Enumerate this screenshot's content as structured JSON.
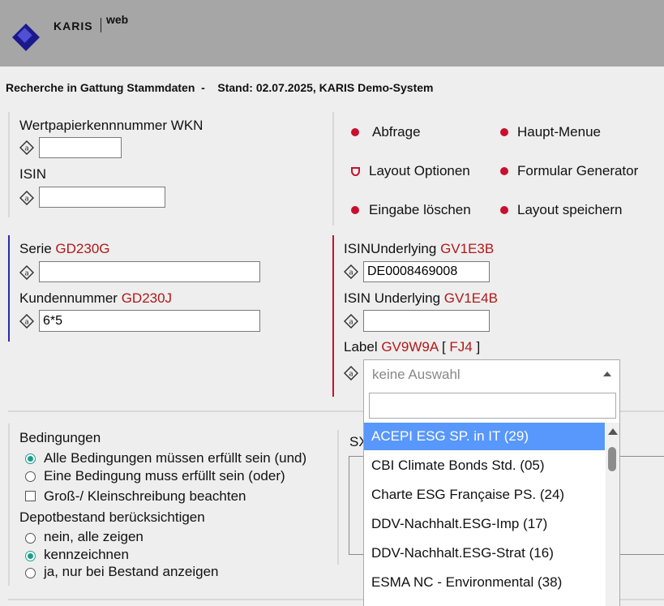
{
  "brand": {
    "name": "KARIS",
    "suffix": "web"
  },
  "title": "Recherche in Gattung Stammdaten  -    Stand: 02.07.2025, KARIS Demo-System",
  "fields": {
    "wkn": {
      "label": "Wertpapierkennnummer  WKN",
      "value": ""
    },
    "isin": {
      "label": "ISIN",
      "value": ""
    },
    "serie": {
      "label": "Serie ",
      "code": "GD230G",
      "value": ""
    },
    "kundennummer": {
      "label": "Kundennummer ",
      "code": "GD230J",
      "value": "6*5"
    },
    "isin_underlying1": {
      "label": "ISINUnderlying ",
      "code": "GV1E3B",
      "value": "DE0008469008"
    },
    "isin_underlying2": {
      "label": "ISIN Underlying ",
      "code": "GV1E4B",
      "value": ""
    },
    "label_field": {
      "label": "Label ",
      "code": "GV9W9A",
      "bracket_open": " [ ",
      "code2": "FJ4",
      "bracket_close": " ]",
      "placeholder": "keine Auswahl"
    }
  },
  "menu": {
    "abfrage": "Abfrage",
    "haupt_menue": "Haupt-Menue",
    "layout_optionen": "Layout Optionen",
    "formular_generator": "Formular Generator",
    "eingabe_loeschen": "Eingabe löschen",
    "layout_speichern": "Layout speichern"
  },
  "conditions": {
    "title": "Bedingungen",
    "all": "Alle Bedingungen müssen erfüllt sein (und)",
    "one": "Eine Bedingung muss erfüllt sein (oder)",
    "case": "Groß-/ Kleinschreibung beachten"
  },
  "depot": {
    "title": "Depotbestand berücksichtigen",
    "no": "nein, alle zeigen",
    "mark": "kennzeichnen",
    "only": "ja, nur bei Bestand anzeigen"
  },
  "sx_label": "SX",
  "dropdown": {
    "options": [
      "ACEPI ESG SP. in IT (29)",
      "CBI Climate Bonds Std. (05)",
      "Charte ESG Française PS. (24)",
      "DDV-Nachhalt.ESG-Imp (17)",
      "DDV-Nachhalt.ESG-Strat (16)",
      "ESMA NC - Environmental (38)"
    ],
    "highlighted_index": 0
  },
  "colors": {
    "accent_red": "#c8102e",
    "code_red": "#b21818",
    "highlight_blue": "#5897fb",
    "radio_teal": "#1a9e8a"
  }
}
